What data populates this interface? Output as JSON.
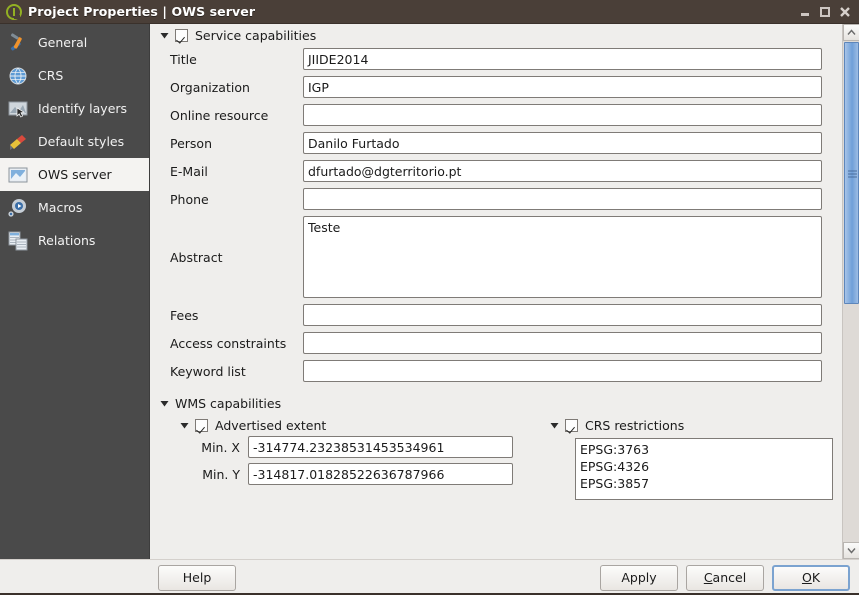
{
  "window": {
    "title": "Project Properties | OWS server",
    "logo_icon": "qgis-logo-icon",
    "minimize_icon": "minimize-icon",
    "maximize_icon": "maximize-icon",
    "close_icon": "close-icon"
  },
  "sidebar": {
    "items": [
      {
        "label": "General",
        "icon": "tools-icon",
        "selected": false
      },
      {
        "label": "CRS",
        "icon": "globe-icon",
        "selected": false
      },
      {
        "label": "Identify layers",
        "icon": "identify-layers-icon",
        "selected": false
      },
      {
        "label": "Default styles",
        "icon": "paintbrush-icon",
        "selected": false
      },
      {
        "label": "OWS server",
        "icon": "ows-server-icon",
        "selected": true
      },
      {
        "label": "Macros",
        "icon": "gear-play-icon",
        "selected": false
      },
      {
        "label": "Relations",
        "icon": "relations-icon",
        "selected": false
      }
    ]
  },
  "service_capabilities": {
    "group_label": "Service capabilities",
    "checked": true,
    "expanded": true,
    "fields": [
      {
        "label": "Title",
        "value": "JIIDE2014"
      },
      {
        "label": "Organization",
        "value": "IGP"
      },
      {
        "label": "Online resource",
        "value": ""
      },
      {
        "label": "Person",
        "value": "Danilo Furtado"
      },
      {
        "label": "E-Mail",
        "value": "dfurtado@dgterritorio.pt"
      },
      {
        "label": "Phone",
        "value": ""
      }
    ],
    "abstract": {
      "label": "Abstract",
      "value": "Teste"
    },
    "fields_after": [
      {
        "label": "Fees",
        "value": ""
      },
      {
        "label": "Access constraints",
        "value": ""
      },
      {
        "label": "Keyword list",
        "value": ""
      }
    ]
  },
  "wms_capabilities": {
    "group_label": "WMS capabilities",
    "expanded": true,
    "advertised_extent": {
      "label": "Advertised extent",
      "checked": true,
      "expanded": true,
      "rows": [
        {
          "label": "Min. X",
          "value": "-314774.23238531453534961"
        },
        {
          "label": "Min. Y",
          "value": "-314817.01828522636787966"
        }
      ]
    },
    "crs_restrictions": {
      "label": "CRS restrictions",
      "checked": true,
      "expanded": true,
      "items": [
        "EPSG:3763",
        "EPSG:4326",
        "EPSG:3857"
      ]
    }
  },
  "buttons": {
    "help": "Help",
    "apply": "Apply",
    "cancel_pre": "C",
    "cancel_post": "ancel",
    "ok_pre": "O",
    "ok_post": "K"
  },
  "scrollbar": {
    "up_icon": "chevron-up-icon",
    "down_icon": "chevron-down-icon"
  },
  "colors": {
    "titlebar": "#4a3f38",
    "sidebar": "#4a4a4a",
    "pane": "#efeeec",
    "accent": "#6f9fd8"
  }
}
